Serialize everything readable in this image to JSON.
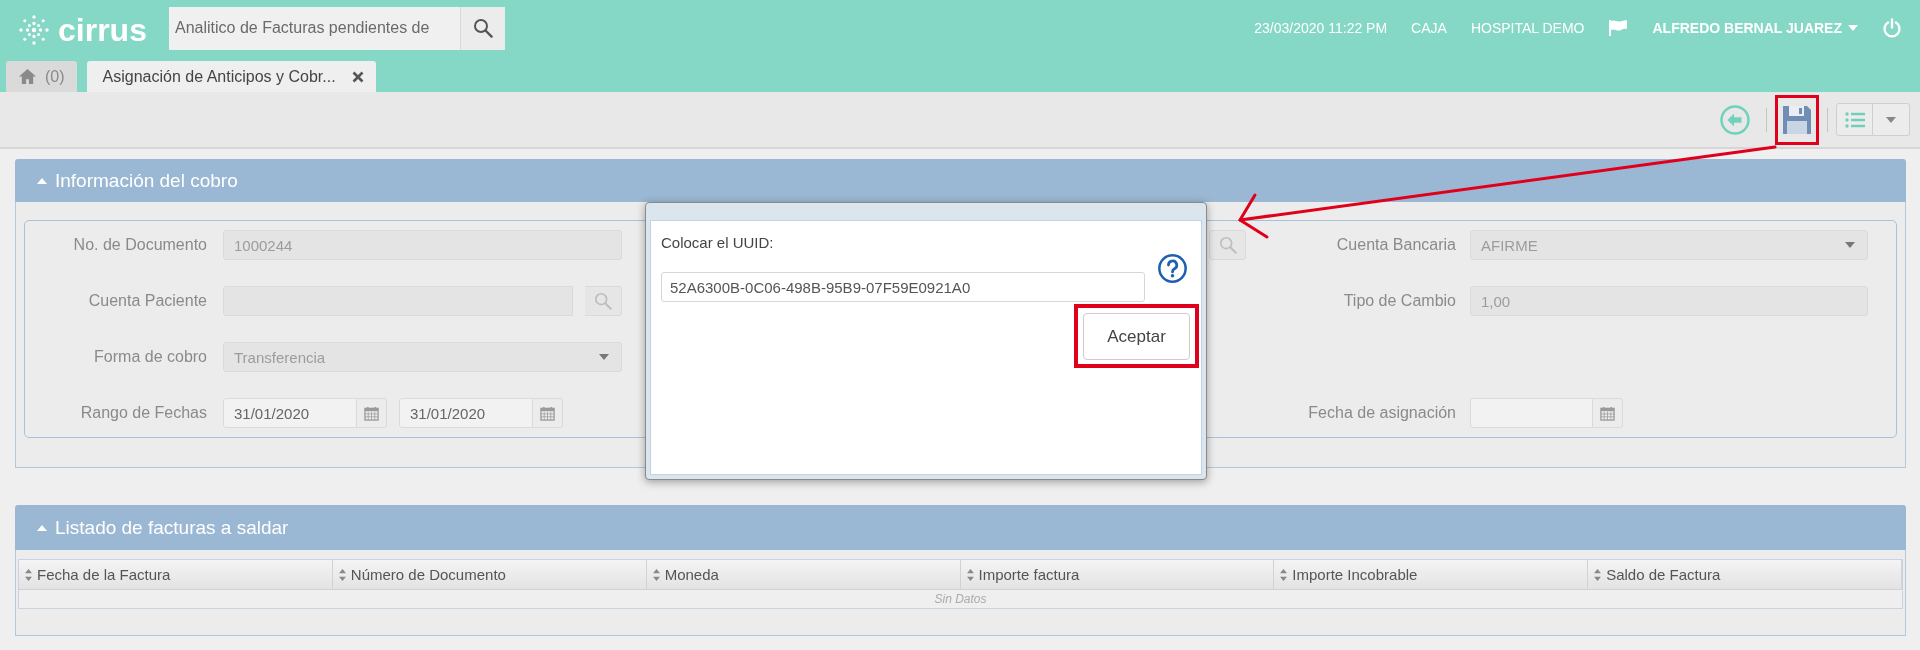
{
  "header": {
    "logo": "cirrus",
    "search": {
      "value": "Analitico de Facturas pendientes de"
    },
    "datetime": "23/03/2020 11:22 PM",
    "station": "CAJA",
    "hospital": "HOSPITAL DEMO",
    "user": "ALFREDO BERNAL JUAREZ"
  },
  "tabs": [
    {
      "kind": "home",
      "label": "(0)",
      "selected": false,
      "closable": false
    },
    {
      "kind": "page",
      "label": "Asignación de Anticipos y Cobr...",
      "selected": true,
      "closable": true
    }
  ],
  "toolbar": [
    {
      "kind": "back",
      "highlighted": false
    },
    {
      "kind": "save",
      "highlighted": true
    },
    {
      "kind": "list",
      "highlighted": false
    },
    {
      "kind": "menu",
      "highlighted": false
    }
  ],
  "payment_info": {
    "title": "Información del cobro",
    "expanded": true,
    "rows": [
      {
        "left": {
          "kind": "text",
          "label": "No. de Documento",
          "value": "1000244",
          "disabled": true
        },
        "middle": {
          "kind": "search_button"
        },
        "right": {
          "kind": "select",
          "label": "Cuenta Bancaria",
          "value": "AFIRME",
          "disabled": true
        }
      },
      {
        "left": {
          "kind": "search",
          "label": "Cuenta Paciente",
          "disabled": true
        },
        "right": {
          "kind": "text",
          "label": "Tipo de Cambio",
          "value": "1,00",
          "disabled": true
        }
      },
      {
        "left": {
          "kind": "select",
          "label": "Forma de cobro",
          "value": "Transferencia",
          "disabled": true
        }
      },
      {
        "left": {
          "kind": "daterange",
          "label": "Rango de Fechas",
          "from": "31/01/2020",
          "to": "31/01/2020",
          "disabled": false
        },
        "right": {
          "kind": "date",
          "label": "Fecha de asignación",
          "disabled": false
        }
      }
    ]
  },
  "uuid_dialog": {
    "prompt": "Colocar el UUID:",
    "value": "52A6300B-0C06-498B-95B9-07F59E0921A0",
    "button": {
      "label": "Aceptar",
      "highlighted": true
    }
  },
  "invoices": {
    "title": "Listado de facturas a saldar",
    "expanded": true,
    "columns": [
      "Fecha de la Factura",
      "Número de Documento",
      "Moneda",
      "Importe factura",
      "Importe Incobrable",
      "Saldo de Factura"
    ],
    "empty_text": "Sin Datos"
  }
}
